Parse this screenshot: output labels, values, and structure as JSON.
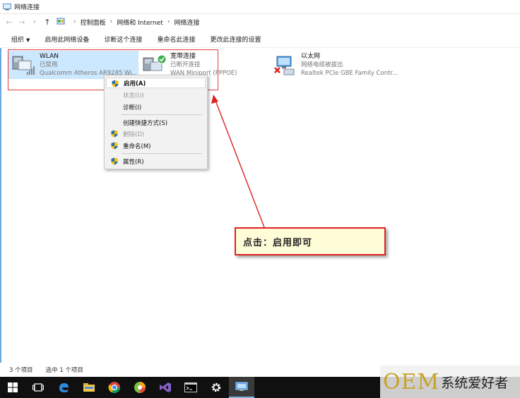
{
  "window": {
    "title": "网络连接"
  },
  "address": {
    "crumbs": [
      "控制面板",
      "网络和 Internet",
      "网络连接"
    ]
  },
  "commands": {
    "organize": "组织",
    "enable_device": "启用此网络设备",
    "diagnose": "诊断这个连接",
    "rename": "重命名此连接",
    "change_settings": "更改此连接的设置"
  },
  "connections": [
    {
      "name": "WLAN",
      "status": "已禁用",
      "device": "Qualcomm Atheros AR9285 Wi..."
    },
    {
      "name": "宽带连接",
      "status": "已断开连接",
      "device": "WAN Miniport (PPPOE)"
    },
    {
      "name": "以太网",
      "status": "网络电缆被拔出",
      "device": "Realtek PCIe GBE Family Contr..."
    }
  ],
  "context_menu": {
    "enable": "启用(A)",
    "status": "状态(U)",
    "diagnose": "诊断(I)",
    "create_shortcut": "创建快捷方式(S)",
    "delete": "删除(D)",
    "rename": "重命名(M)",
    "properties": "属性(R)"
  },
  "callout": {
    "text": "点击：启用即可"
  },
  "statusbar": {
    "count": "3 个项目",
    "selected": "选中 1 个项目"
  },
  "watermark": {
    "brand": "OEM",
    "text": "系统爱好者"
  },
  "colors": {
    "accent_red": "#dd2222",
    "selection": "#cce8ff",
    "callout_bg": "#fffcd8"
  }
}
